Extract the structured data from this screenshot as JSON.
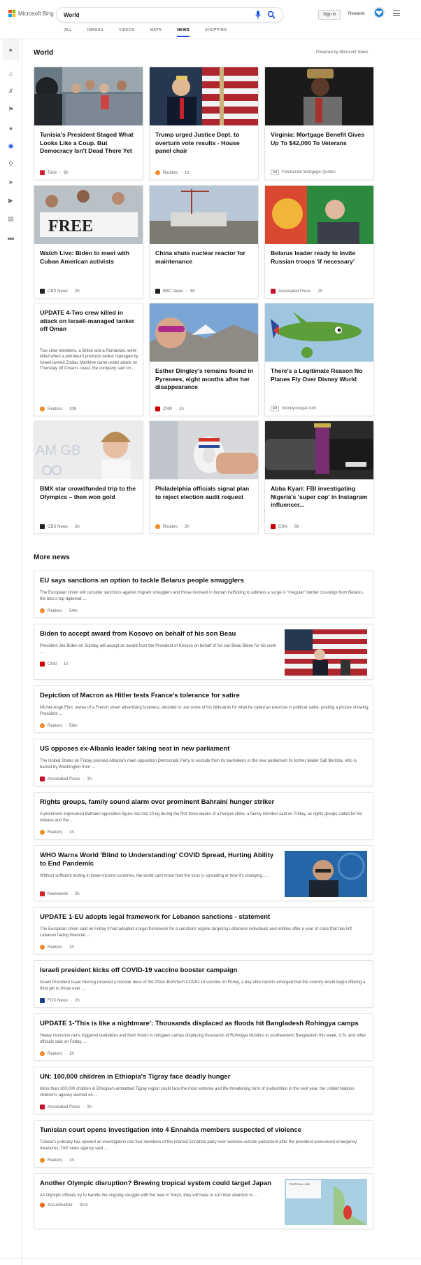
{
  "brand": "Microsoft Bing",
  "search": {
    "value": "World",
    "placeholder": ""
  },
  "header": {
    "signin": "Sign in",
    "rewards": "Rewards"
  },
  "scopes": [
    "ALL",
    "IMAGES",
    "VIDEOS",
    "MAPS",
    "NEWS",
    "SHOPPING"
  ],
  "active_scope": "NEWS",
  "section": {
    "title": "World",
    "powered": "Powered by Microsoft News"
  },
  "cards": [
    {
      "title": "Tunisia's President Staged What Looks Like a Coup. But Democracy Isn't Dead There Yet",
      "source": "Time",
      "time": "6h",
      "logo_color": "#d2232a",
      "ad": false
    },
    {
      "title": "Trump urged Justice Dept. to overturn vote results - House panel chair",
      "source": "Reuters",
      "time": "1h",
      "logo_color": "#f28c28",
      "ad": false
    },
    {
      "title": "Virginia: Mortgage Benefit Gives Up To $42,000 To Veterans",
      "source": "Fetcharate Mortgage Quotes",
      "time": "",
      "logo_color": "",
      "ad": true
    },
    {
      "title": "Watch Live: Biden to meet with Cuban American activists",
      "source": "CBS News",
      "time": "2h",
      "logo_color": "#222222",
      "ad": false
    },
    {
      "title": "China shuts nuclear reactor for maintenance",
      "source": "BBC News",
      "time": "5h",
      "logo_color": "#222222",
      "ad": false
    },
    {
      "title": "Belarus leader ready to invite Russian troops 'if necessary'",
      "source": "Associated Press",
      "time": "2h",
      "logo_color": "#c8102e",
      "ad": false
    },
    {
      "title": "UPDATE 4-Two crew killed in attack on Israeli-managed tanker off Oman",
      "snippet": "Two crew members, a Briton and a Romanian, were killed when a petroleum products tanker managed by Israeli-owned Zodiac Maritime came under attack on Thursday off Oman's coast, the company said on ...",
      "source": "Reuters",
      "time": "10h",
      "logo_color": "#f28c28",
      "ad": false
    },
    {
      "title": "Esther Dingley's remains found in Pyrenees, eight months after her disappearance",
      "source": "CNN",
      "time": "1h",
      "logo_color": "#cc0000",
      "ad": false
    },
    {
      "title": "There's a Legitimate Reason No Planes Fly Over Disney World",
      "source": "moneycougar.com",
      "time": "",
      "logo_color": "",
      "ad": true
    },
    {
      "title": "BMX star crowdfunded trip to the Olympics – then won gold",
      "source": "CBS News",
      "time": "2h",
      "logo_color": "#222222",
      "ad": false
    },
    {
      "title": "Philadelphia officials signal plan to reject election audit request",
      "source": "Reuters",
      "time": "2h",
      "logo_color": "#f28c28",
      "ad": false
    },
    {
      "title": "Abba Kyari: FBI investigating Nigeria's 'super cop' in Instagram influencer...",
      "source": "CNN",
      "time": "6h",
      "logo_color": "#cc0000",
      "ad": false
    }
  ],
  "ad_label": "Ad",
  "more": {
    "title": "More news",
    "items": [
      {
        "title": "EU says sanctions an option to tackle Belarus people smugglers",
        "snippet": "The European Union will consider sanctions against migrant smugglers and those involved in human trafficking to address a surge in \"irregular\" border crossings from Belarus, the bloc's top diplomat ...",
        "source": "Reuters",
        "time": "54m",
        "logo_color": "#f28c28",
        "thumb": false
      },
      {
        "title": "Biden to accept award from Kosovo on behalf of his son Beau",
        "snippet": "President Joe Biden on Sunday will accept an award from the President of Kosovo on behalf of his son Beau Biden for his work ...",
        "source": "CNN",
        "time": "1h",
        "logo_color": "#cc0000",
        "thumb": true
      },
      {
        "title": "Depiction of Macron as Hitler tests France's tolerance for satire",
        "snippet": "Michel-Ange Flori, owner of a French street advertising business, decided to use some of his billboards for what he called an exercise in political satire: posting a picture showing President ...",
        "source": "Reuters",
        "time": "59m",
        "logo_color": "#f28c28",
        "thumb": false
      },
      {
        "title": "US opposes ex-Albania leader taking seat in new parliament",
        "snippet": "The United States on Friday pressed Albania's main opposition Democratic Party to exclude from its lawmakers in the new parliament its former leader Sali Berisha, who is barred by Washington from ...",
        "source": "Associated Press",
        "time": "1h",
        "logo_color": "#c8102e",
        "thumb": false
      },
      {
        "title": "Rights groups, family sound alarm over prominent Bahraini hunger striker",
        "snippet": "A prominent imprisoned Bahraini opposition figure has lost 10 kg during the first three weeks of a hunger strike, a family member said on Friday, as rights groups called for his release and the ...",
        "source": "Reuters",
        "time": "1h",
        "logo_color": "#f28c28",
        "thumb": false
      },
      {
        "title": "WHO Warns World 'Blind to Understanding' COVID Spread, Hurting Ability to End Pandemic",
        "snippet": "Without sufficient testing in lower-income countries, the world can't know how the virus is spreading or how it's changing, ...",
        "source": "Newsweek",
        "time": "2h",
        "logo_color": "#d2232a",
        "thumb": true
      },
      {
        "title": "UPDATE 1-EU adopts legal framework for Lebanon sanctions - statement",
        "snippet": "The European Union said on Friday it had adopted a legal framework for a sanctions regime targeting Lebanese individuals and entities after a year of crisis that has left Lebanon facing financial ...",
        "source": "Reuters",
        "time": "1h",
        "logo_color": "#f28c28",
        "thumb": false
      },
      {
        "title": "Israeli president kicks off COVID-19 vaccine booster campaign",
        "snippet": "Israeli President Isaac Herzog received a booster dose of the Pfizer-BioNTech COVID-19 vaccine on Friday, a day after reports emerged that the country would begin offering a third jab to those over ...",
        "source": "FOX News",
        "time": "2h",
        "logo_color": "#1c3f94",
        "thumb": false
      },
      {
        "title": "UPDATE 1-'This is like a nightmare': Thousands displaced as floods hit Bangladesh Rohingya camps",
        "snippet": "Heavy monsoon rains triggered landslides and flash floods in refugees camps displacing thousands of Rohingya Muslims in southeastern Bangladesh this week, U.N. and other officials said on Friday, ...",
        "source": "Reuters",
        "time": "1h",
        "logo_color": "#f28c28",
        "thumb": false
      },
      {
        "title": "UN: 100,000 children in Ethiopia's Tigray face deadly hunger",
        "snippet": "More than 100,000 children in Ethiopia's embattled Tigray region could face the most extreme and life-threatening form of malnutrition in the next year, the United Nations children's agency warned on ...",
        "source": "Associated Press",
        "time": "3h",
        "logo_color": "#c8102e",
        "thumb": false
      },
      {
        "title": "Tunisian court opens investigation into 4 Ennahda members suspected of violence",
        "snippet": "Tunisia's judiciary has opened an investigation into four members of the Islamist Ennahda party over violence outside parliament after the president announced emergency measures, TAP news agency said ...",
        "source": "Reuters",
        "time": "1h",
        "logo_color": "#f28c28",
        "thumb": false
      },
      {
        "title": "Another Olympic disruption? Brewing tropical system could target Japan",
        "snippet": "As Olympic officials try to handle the ongoing struggle with the heat in Tokyo, they will have to turn their attention to ...",
        "source": "AccuWeather",
        "time": "41m",
        "logo_color": "#f26522",
        "thumb": true
      }
    ]
  },
  "thumb_labels": {
    "tropical": "TROPICAL LOW"
  }
}
